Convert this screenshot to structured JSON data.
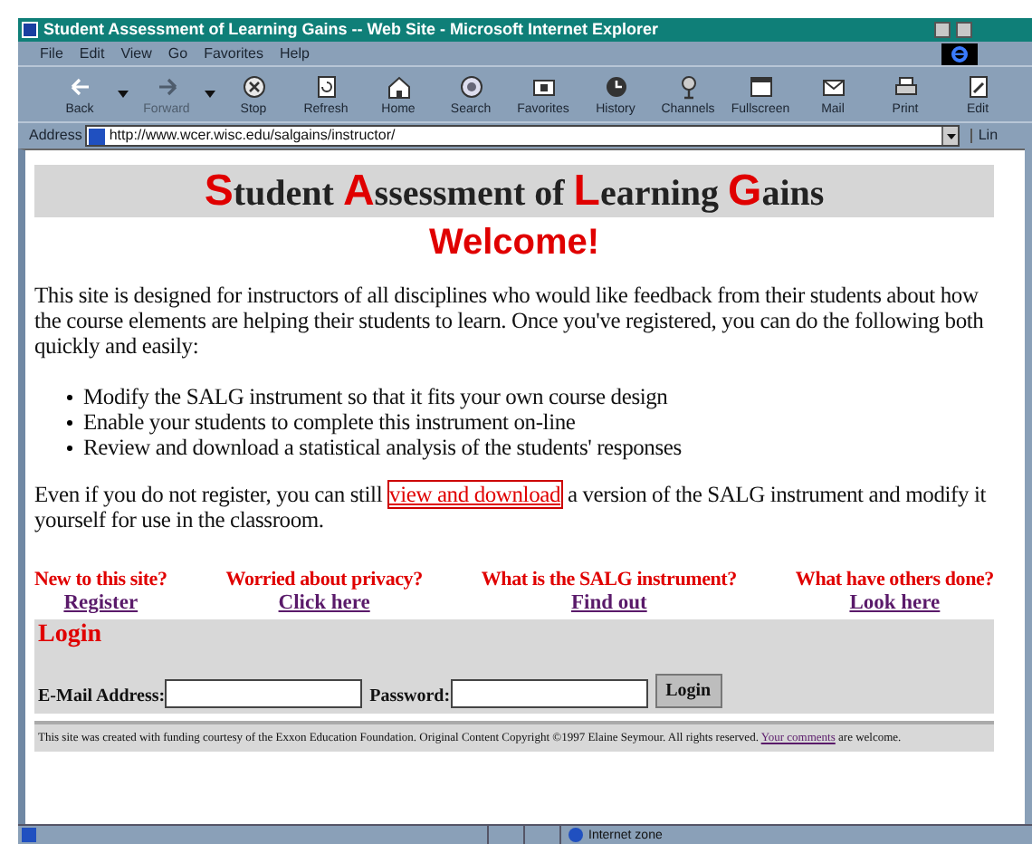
{
  "window": {
    "title": "Student Assessment of Learning Gains -- Web Site - Microsoft Internet Explorer"
  },
  "menu": [
    "File",
    "Edit",
    "View",
    "Go",
    "Favorites",
    "Help"
  ],
  "toolbar": [
    {
      "label": "Back",
      "disabled": false,
      "dropdown": true
    },
    {
      "label": "Forward",
      "disabled": true,
      "dropdown": true
    },
    {
      "label": "Stop",
      "disabled": false,
      "dropdown": false
    },
    {
      "label": "Refresh",
      "disabled": false,
      "dropdown": false
    },
    {
      "label": "Home",
      "disabled": false,
      "dropdown": false
    },
    {
      "label": "Search",
      "disabled": false,
      "dropdown": false
    },
    {
      "label": "Favorites",
      "disabled": false,
      "dropdown": false
    },
    {
      "label": "History",
      "disabled": false,
      "dropdown": false
    },
    {
      "label": "Channels",
      "disabled": false,
      "dropdown": false
    },
    {
      "label": "Fullscreen",
      "disabled": false,
      "dropdown": false
    },
    {
      "label": "Mail",
      "disabled": false,
      "dropdown": false
    },
    {
      "label": "Print",
      "disabled": false,
      "dropdown": false
    },
    {
      "label": "Edit",
      "disabled": false,
      "dropdown": false
    }
  ],
  "address": {
    "label": "Address",
    "url": "http://www.wcer.wisc.edu/salgains/instructor/",
    "links": "Lin"
  },
  "page": {
    "header": [
      {
        "text": "S",
        "accent": true
      },
      {
        "text": "tudent ",
        "accent": false
      },
      {
        "text": "A",
        "accent": true
      },
      {
        "text": "ssessment of ",
        "accent": false
      },
      {
        "text": "L",
        "accent": true
      },
      {
        "text": "earning ",
        "accent": false
      },
      {
        "text": "G",
        "accent": true
      },
      {
        "text": "ains",
        "accent": false
      }
    ],
    "welcome": "Welcome!",
    "intro": "This site is designed for instructors of all disciplines who would like feedback from their students about how the course elements are helping their students to learn. Once you've registered, you can do the following both quickly and easily:",
    "bullets": [
      "Modify the SALG instrument so that it fits your own course design",
      "Enable your students to complete this instrument on-line",
      "Review and download a statistical analysis of the students' responses"
    ],
    "note": {
      "before": "Even if you do not register, you can still",
      "link": "view and download",
      "after": "a version of the SALG instrument and modify it yourself for use in the classroom."
    },
    "questions": [
      {
        "question": "New to this site?",
        "link": "Register"
      },
      {
        "question": "Worried about privacy?",
        "link": "Click here"
      },
      {
        "question": "What is the SALG instrument?",
        "link": "Find out"
      },
      {
        "question": "What have others done?",
        "link": "Look here"
      }
    ],
    "login": {
      "heading": "Login",
      "email_label": "E-Mail Address:",
      "password_label": "Password:",
      "button": "Login"
    },
    "footer": {
      "text": "This site was created with funding courtesy of the Exxon Education Foundation. Original Content Copyright ©1997 Elaine Seymour. All rights reserved.",
      "link": "Your comments",
      "after": "are welcome."
    }
  },
  "status_bar": {
    "zone": "Internet zone"
  }
}
